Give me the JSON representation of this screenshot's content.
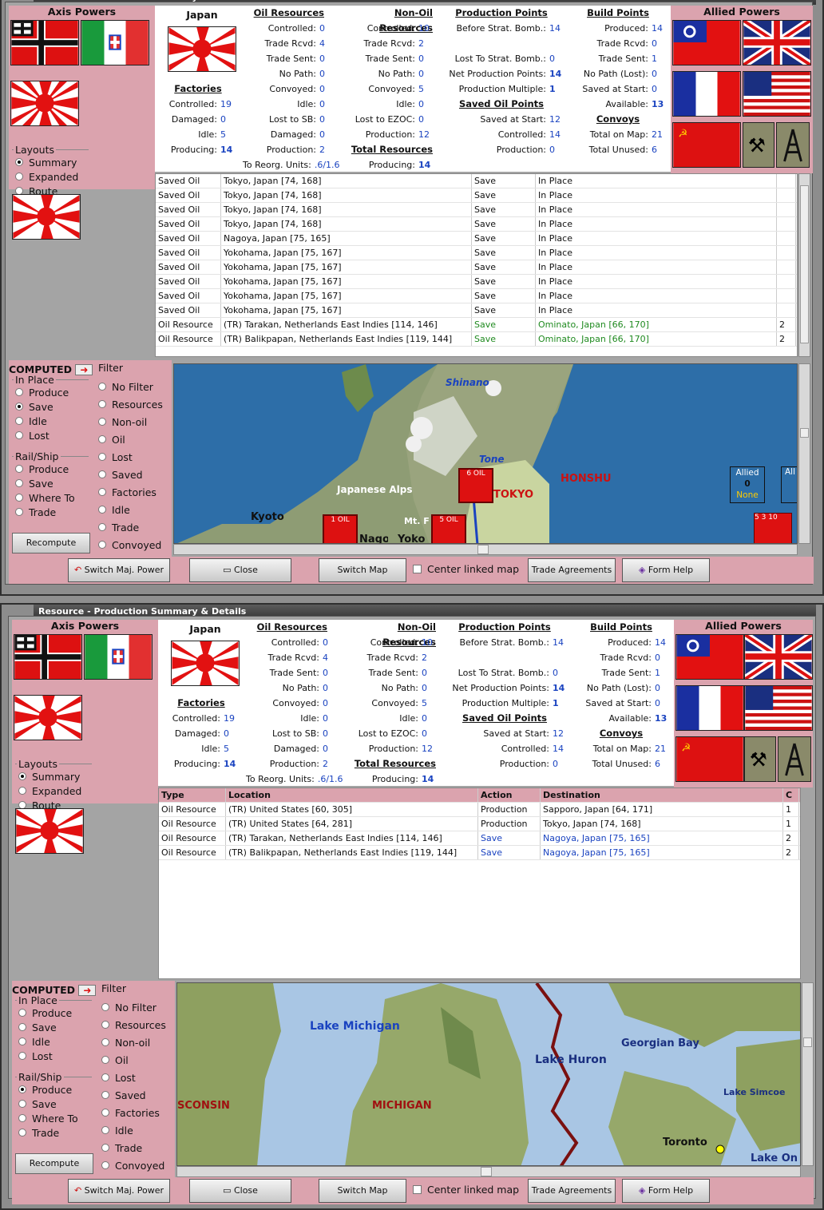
{
  "window_title": "Resource - Production Summary & Details",
  "axis_label": "Axis Powers",
  "allied_label": "Allied Powers",
  "country": "Japan",
  "layouts": {
    "label": "Layouts",
    "options": [
      "Summary",
      "Expanded",
      "Route"
    ],
    "selected": "Summary"
  },
  "computed_label": "COMPUTED",
  "in_place": {
    "label": "In Place",
    "options": [
      "Produce",
      "Save",
      "Idle",
      "Lost"
    ]
  },
  "rail_ship": {
    "label": "Rail/Ship",
    "options": [
      "Produce",
      "Save",
      "Where To",
      "Trade"
    ]
  },
  "filter": {
    "label": "Filter",
    "options": [
      "No Filter",
      "Resources",
      "Non-oil",
      "Oil",
      "Lost",
      "Saved",
      "Factories",
      "Idle",
      "Trade",
      "Convoyed"
    ]
  },
  "recompute_label": "Recompute",
  "buttons": {
    "switch_major": "Switch Maj. Power",
    "close": "Close",
    "switch_map": "Switch Map",
    "center_linked": "Center linked map",
    "trade": "Trade Agreements",
    "help": "Form Help"
  },
  "summary": {
    "oil": {
      "title": "Oil Resources",
      "rows": [
        [
          "Controlled:",
          "0"
        ],
        [
          "Trade Rcvd:",
          "4"
        ],
        [
          "Trade Sent:",
          "0"
        ],
        [
          "No Path:",
          "0"
        ],
        [
          "Convoyed:",
          "0"
        ],
        [
          "Idle:",
          "0"
        ],
        [
          "Lost to SB:",
          "0"
        ],
        [
          "Damaged:",
          "0"
        ],
        [
          "Production:",
          "2"
        ]
      ]
    },
    "nonoil": {
      "title": "Non-Oil Resources",
      "rows": [
        [
          "Controlled:",
          "10"
        ],
        [
          "Trade Rcvd:",
          "2"
        ],
        [
          "Trade Sent:",
          "0"
        ],
        [
          "No Path:",
          "0"
        ],
        [
          "Convoyed:",
          "5"
        ],
        [
          "Idle:",
          "0"
        ],
        [
          "Lost to EZOC:",
          "0"
        ],
        [
          "Production:",
          "12"
        ]
      ]
    },
    "total": {
      "title": "Total Resources",
      "rows": [
        [
          "Producing:",
          "14"
        ]
      ]
    },
    "factories": {
      "title": "Factories",
      "rows": [
        [
          "Controlled:",
          "19"
        ],
        [
          "Damaged:",
          "0"
        ],
        [
          "Idle:",
          "5"
        ],
        [
          "Producing:",
          "14"
        ]
      ]
    },
    "reorg": [
      "To Reorg. Units:",
      ".6/1.6"
    ],
    "pp": {
      "title": "Production Points",
      "rows": [
        [
          "Before Strat. Bomb.:",
          "14"
        ],
        [
          "",
          ""
        ],
        [
          "Lost To Strat. Bomb.:",
          "0"
        ],
        [
          "Net Production Points:",
          "14"
        ],
        [
          "Production Multiple:",
          "1"
        ]
      ]
    },
    "savedoil": {
      "title": "Saved Oil Points",
      "rows": [
        [
          "Saved at Start:",
          "12"
        ],
        [
          "Controlled:",
          "14"
        ],
        [
          "Production:",
          "0"
        ]
      ]
    },
    "build": {
      "title": "Build Points",
      "rows": [
        [
          "Produced:",
          "14"
        ],
        [
          "Trade Rcvd:",
          "0"
        ],
        [
          "Trade Sent:",
          "1"
        ],
        [
          "No Path (Lost):",
          "0"
        ],
        [
          "Saved at Start:",
          "0"
        ],
        [
          "Available:",
          "13"
        ]
      ]
    },
    "convoys": {
      "title": "Convoys",
      "rows": [
        [
          "Total on Map:",
          "21"
        ],
        [
          "Total Unused:",
          "6"
        ]
      ]
    }
  },
  "table1": [
    [
      "Saved Oil",
      "Tokyo, Japan [74, 168]",
      "Save",
      "In Place",
      ""
    ],
    [
      "Saved Oil",
      "Tokyo, Japan [74, 168]",
      "Save",
      "In Place",
      ""
    ],
    [
      "Saved Oil",
      "Tokyo, Japan [74, 168]",
      "Save",
      "In Place",
      ""
    ],
    [
      "Saved Oil",
      "Tokyo, Japan [74, 168]",
      "Save",
      "In Place",
      ""
    ],
    [
      "Saved Oil",
      "Nagoya, Japan [75, 165]",
      "Save",
      "In Place",
      ""
    ],
    [
      "Saved Oil",
      "Yokohama, Japan [75, 167]",
      "Save",
      "In Place",
      ""
    ],
    [
      "Saved Oil",
      "Yokohama, Japan [75, 167]",
      "Save",
      "In Place",
      ""
    ],
    [
      "Saved Oil",
      "Yokohama, Japan [75, 167]",
      "Save",
      "In Place",
      ""
    ],
    [
      "Saved Oil",
      "Yokohama, Japan [75, 167]",
      "Save",
      "In Place",
      ""
    ],
    [
      "Saved Oil",
      "Yokohama, Japan [75, 167]",
      "Save",
      "In Place",
      ""
    ],
    [
      "Oil Resource",
      "(TR) Tarakan, Netherlands East Indies [114, 146]",
      "Save",
      "Ominato, Japan [66, 170]",
      "2"
    ],
    [
      "Oil Resource",
      "(TR) Balikpapan, Netherlands East Indies [119, 144]",
      "Save",
      "Ominato, Japan [66, 170]",
      "2"
    ]
  ],
  "table2_headers": [
    "Type",
    "Location",
    "Action",
    "Destination",
    "C"
  ],
  "table2": [
    [
      "Oil Resource",
      "(TR) United States [60, 305]",
      "Production",
      "Sapporo, Japan [64, 171]",
      "1"
    ],
    [
      "Oil Resource",
      "(TR) United States [64, 281]",
      "Production",
      "Tokyo, Japan [74, 168]",
      "1"
    ],
    [
      "Oil Resource",
      "(TR) Tarakan, Netherlands East Indies [114, 146]",
      "Save",
      "Nagoya, Japan [75, 165]",
      "2"
    ],
    [
      "Oil Resource",
      "(TR) Balikpapan, Netherlands East Indies [119, 144]",
      "Save",
      "Nagoya, Japan [75, 165]",
      "2"
    ]
  ],
  "map1": {
    "labels": [
      "Shinano",
      "Tone",
      "Japanese Alps",
      "HONSHU",
      "Kyoto",
      "Mt. F",
      "Nagoya",
      "Yoko",
      "TOKYO"
    ],
    "counters": [
      "6 OIL",
      "1 OIL",
      "5 OIL"
    ],
    "allied_box": {
      "title": "Allied",
      "value": "0",
      "sub": "None"
    },
    "stack": [
      "5",
      "3",
      "10"
    ]
  },
  "map2": {
    "labels": [
      "Lake Michigan",
      "Lake Huron",
      "Georgian Bay",
      "Lake Simcoe",
      "MICHIGAN",
      "SCONSIN",
      "Toronto",
      "Lake On"
    ]
  },
  "colors": {
    "pink": "#dba3ae",
    "blue": "#1a43c0",
    "green": "#1f8a1f"
  }
}
